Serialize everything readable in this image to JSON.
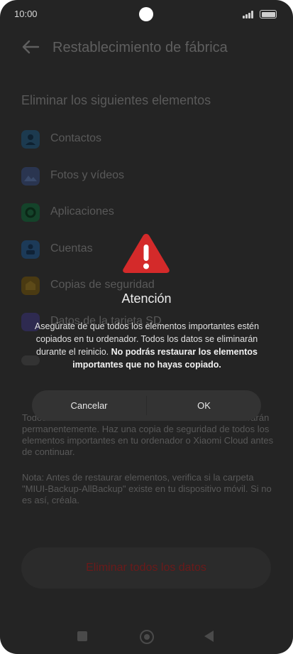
{
  "status_bar": {
    "time": "10:00"
  },
  "header": {
    "title": "Restablecimiento de fábrica"
  },
  "section": {
    "title": "Eliminar los siguientes elementos"
  },
  "items": [
    {
      "label": "Contactos",
      "icon": "contacts-icon",
      "color": "#1c3a4f"
    },
    {
      "label": "Fotos y vídeos",
      "icon": "gallery-icon",
      "color": "#2a3550"
    },
    {
      "label": "Aplicaciones",
      "icon": "apps-icon",
      "color": "#14432a"
    },
    {
      "label": "Cuentas",
      "icon": "accounts-icon",
      "color": "#1c3a58"
    },
    {
      "label": "Copias de seguridad",
      "icon": "backup-icon",
      "color": "#4a3a12"
    },
    {
      "label": "Datos de la tarjeta SD",
      "icon": "sd-card-icon",
      "color": "#2e2a50"
    }
  ],
  "notes": {
    "paragraph1": "Todos los elementos enumerados anteriormente se borrarán permanentemente. Haz una copia de seguridad de todos los elementos importantes en tu ordenador o Xiaomi Cloud antes de continuar.",
    "paragraph2": "Nota: Antes de restaurar elementos, verifica si la carpeta \"MIUI-Backup-AllBackup\" existe en tu dispositivo móvil. Si no es así, créala."
  },
  "delete_button": {
    "label": "Eliminar todos los datos"
  },
  "dialog": {
    "title": "Atención",
    "message_regular": "Asegúrate de que todos los elementos importantes estén copiados en tu ordenador. Todos los datos se eliminarán durante el reinicio.",
    "message_bold": "No podrás restaurar los elementos importantes que no hayas copiado.",
    "cancel_label": "Cancelar",
    "ok_label": "OK",
    "warning_color": "#d42a2a"
  }
}
